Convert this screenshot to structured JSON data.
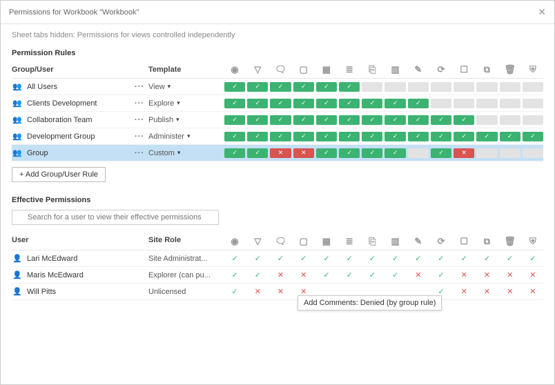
{
  "header": {
    "title": "Permissions for Workbook \"Workbook\""
  },
  "subtitle": "Sheet tabs hidden: Permissions for views controlled independently",
  "section_rules": "Permission Rules",
  "col_group_user": "Group/User",
  "col_template": "Template",
  "perm_icons": [
    "👁",
    "⚗",
    "💬",
    "⬇",
    "🖼",
    "≣",
    "⎘",
    "▧",
    "✎",
    "⟳",
    "☐",
    "⧉",
    "🗑",
    "⛨"
  ],
  "rules": [
    {
      "name": "All Users",
      "template": "View",
      "perms": [
        "a",
        "a",
        "a",
        "a",
        "a",
        "a",
        "n",
        "n",
        "n",
        "n",
        "n",
        "n",
        "n",
        "n"
      ]
    },
    {
      "name": "Clients Development",
      "template": "Explore",
      "perms": [
        "a",
        "a",
        "a",
        "a",
        "a",
        "a",
        "a",
        "a",
        "a",
        "n",
        "n",
        "n",
        "n",
        "n"
      ]
    },
    {
      "name": "Collaboration Team",
      "template": "Publish",
      "perms": [
        "a",
        "a",
        "a",
        "a",
        "a",
        "a",
        "a",
        "a",
        "a",
        "a",
        "a",
        "n",
        "n",
        "n"
      ]
    },
    {
      "name": "Development Group",
      "template": "Administer",
      "perms": [
        "a",
        "a",
        "a",
        "a",
        "a",
        "a",
        "a",
        "a",
        "a",
        "a",
        "a",
        "a",
        "a",
        "a"
      ]
    },
    {
      "name": "Group",
      "template": "Custom",
      "selected": true,
      "perms": [
        "a",
        "a",
        "d",
        "d",
        "a",
        "a",
        "a",
        "a",
        "n",
        "a",
        "d",
        "n",
        "n",
        "n"
      ]
    }
  ],
  "add_button": "+ Add Group/User Rule",
  "section_effective": "Effective Permissions",
  "search_placeholder": "Search for a user to view their effective permissions",
  "col_user": "User",
  "col_site_role": "Site Role",
  "users": [
    {
      "name": "Lari McEdward",
      "site_role": "Site Administrat...",
      "perms": [
        "a",
        "a",
        "a",
        "a",
        "a",
        "a",
        "a",
        "a",
        "a",
        "a",
        "a",
        "a",
        "a",
        "a"
      ]
    },
    {
      "name": "Maris McEdward",
      "site_role": "Explorer (can pu...",
      "perms": [
        "a",
        "a",
        "d",
        "d",
        "a",
        "a",
        "a",
        "a",
        "d",
        "a",
        "d",
        "d",
        "d",
        "d"
      ]
    },
    {
      "name": "Will Pitts",
      "site_role": "Unlicensed",
      "perms": [
        "a",
        "d",
        "d",
        "d",
        "",
        "",
        "",
        "",
        "",
        "a",
        "d",
        "d",
        "d",
        "d"
      ]
    }
  ],
  "tooltip_text": "Add Comments: Denied (by group rule)"
}
